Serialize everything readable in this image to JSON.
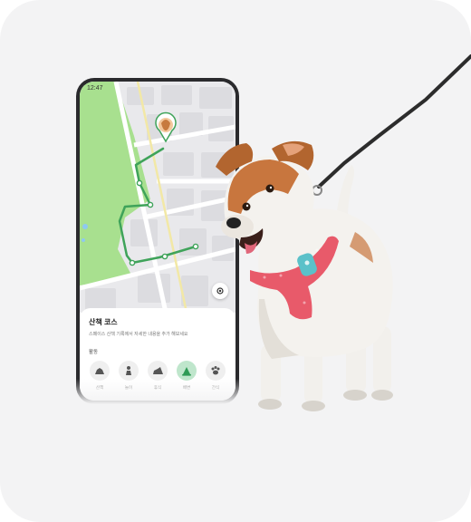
{
  "status": {
    "time": "12:47"
  },
  "sheet": {
    "title": "산책 코스",
    "description": "스페이스 산책 기록에서 자세한 내용을 추가 해보세요",
    "section_label": "활동",
    "categories": [
      {
        "label": "산책",
        "icon": "walk-icon",
        "active": false
      },
      {
        "label": "놀이",
        "icon": "play-icon",
        "active": false
      },
      {
        "label": "휴식",
        "icon": "rest-icon",
        "active": false
      },
      {
        "label": "배변",
        "icon": "poop-icon",
        "active": true
      },
      {
        "label": "간식",
        "icon": "paw-icon",
        "active": false
      }
    ]
  },
  "colors": {
    "background": "#f3f3f4",
    "park_green": "#a8e08f",
    "route_green": "#3fa35a",
    "tag_accent": "#5bc1c9",
    "harness": "#e85a6a"
  }
}
